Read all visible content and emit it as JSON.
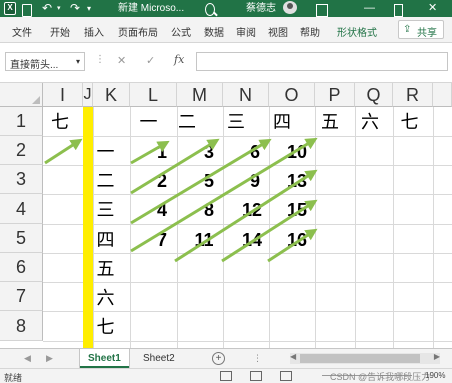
{
  "titlebar": {
    "logo_label": "X",
    "document_title": "新建 Microso...",
    "user_name": "蔡德志",
    "undo_glyph": "↶",
    "undo_dropdown_glyph": "▾",
    "redo_glyph": "↷",
    "more_glyph": "▾",
    "minimize_glyph": "—",
    "close_glyph": "✕"
  },
  "ribbon": {
    "tabs": [
      "文件",
      "开始",
      "插入",
      "页面布局",
      "公式",
      "数据",
      "审阅",
      "视图",
      "帮助",
      "形状格式"
    ],
    "share_icon": "⇪",
    "share_label": "共享"
  },
  "formula_bar": {
    "name_box_value": "直接箭头...",
    "name_box_arrow": "▾",
    "separator": "⋮",
    "cancel_glyph": "✕",
    "enter_glyph": "✓",
    "fx_label": "fx",
    "formula_value": ""
  },
  "grid": {
    "columns": [
      "I",
      "J",
      "K",
      "L",
      "M",
      "N",
      "O",
      "P",
      "Q",
      "R"
    ],
    "rows": [
      "1",
      "2",
      "3",
      "4",
      "5",
      "6",
      "7",
      "8"
    ],
    "row1_values": {
      "I": "七",
      "L": "一",
      "M": "二",
      "N": "三",
      "O": "四",
      "P": "五",
      "Q": "六",
      "R": "七"
    },
    "k_column": [
      "一",
      "二",
      "三",
      "四",
      "五",
      "六",
      "七"
    ],
    "numbers": [
      [
        "1",
        "3",
        "6",
        "10"
      ],
      [
        "2",
        "5",
        "9",
        "13"
      ],
      [
        "4",
        "8",
        "12",
        "15"
      ],
      [
        "7",
        "11",
        "14",
        "16"
      ]
    ],
    "highlight_color": "#ffee00",
    "arrow_color": "#8cbf4e"
  },
  "sheets": {
    "tabs": [
      "Sheet1",
      "Sheet2"
    ],
    "active": "Sheet1",
    "nav_prev": "◀",
    "nav_next": "▶",
    "add_glyph": "+",
    "more_glyph": "⋮",
    "scroll_left": "◀",
    "scroll_right": "▶"
  },
  "statusbar": {
    "ready_label": "就绪",
    "watermark": "CSDN @告诉我哪段压力",
    "zoom": "190%"
  },
  "colors": {
    "excel_green": "#217346"
  }
}
